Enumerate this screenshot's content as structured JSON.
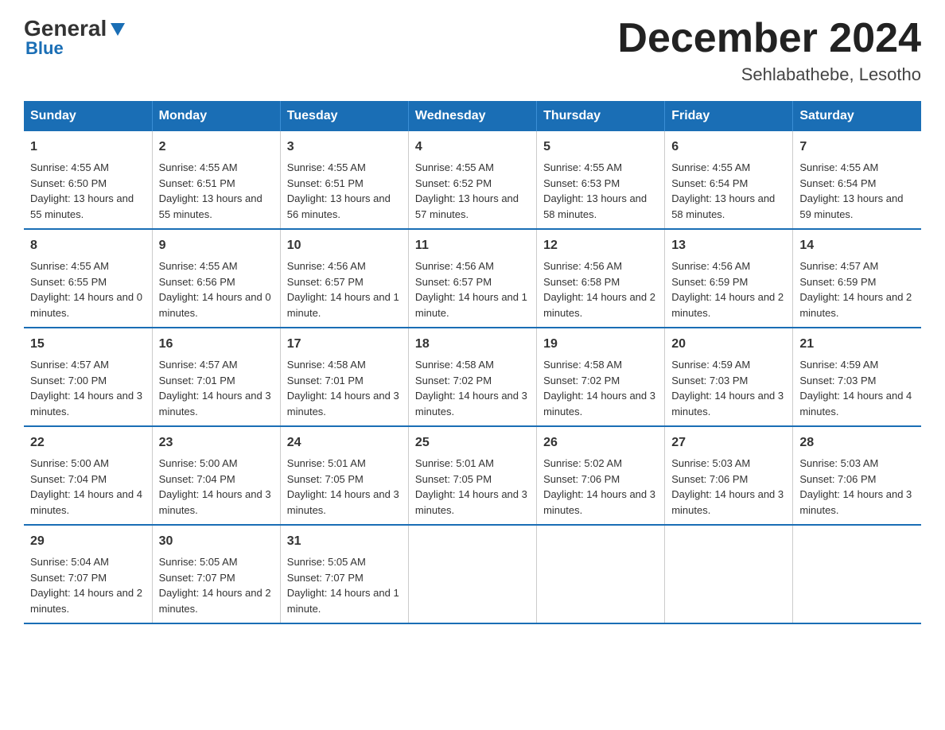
{
  "header": {
    "logo_general": "General",
    "logo_blue": "Blue",
    "month_title": "December 2024",
    "location": "Sehlabathebe, Lesotho"
  },
  "weekdays": [
    "Sunday",
    "Monday",
    "Tuesday",
    "Wednesday",
    "Thursday",
    "Friday",
    "Saturday"
  ],
  "weeks": [
    [
      {
        "day": "1",
        "sunrise": "4:55 AM",
        "sunset": "6:50 PM",
        "daylight": "13 hours and 55 minutes."
      },
      {
        "day": "2",
        "sunrise": "4:55 AM",
        "sunset": "6:51 PM",
        "daylight": "13 hours and 55 minutes."
      },
      {
        "day": "3",
        "sunrise": "4:55 AM",
        "sunset": "6:51 PM",
        "daylight": "13 hours and 56 minutes."
      },
      {
        "day": "4",
        "sunrise": "4:55 AM",
        "sunset": "6:52 PM",
        "daylight": "13 hours and 57 minutes."
      },
      {
        "day": "5",
        "sunrise": "4:55 AM",
        "sunset": "6:53 PM",
        "daylight": "13 hours and 58 minutes."
      },
      {
        "day": "6",
        "sunrise": "4:55 AM",
        "sunset": "6:54 PM",
        "daylight": "13 hours and 58 minutes."
      },
      {
        "day": "7",
        "sunrise": "4:55 AM",
        "sunset": "6:54 PM",
        "daylight": "13 hours and 59 minutes."
      }
    ],
    [
      {
        "day": "8",
        "sunrise": "4:55 AM",
        "sunset": "6:55 PM",
        "daylight": "14 hours and 0 minutes."
      },
      {
        "day": "9",
        "sunrise": "4:55 AM",
        "sunset": "6:56 PM",
        "daylight": "14 hours and 0 minutes."
      },
      {
        "day": "10",
        "sunrise": "4:56 AM",
        "sunset": "6:57 PM",
        "daylight": "14 hours and 1 minute."
      },
      {
        "day": "11",
        "sunrise": "4:56 AM",
        "sunset": "6:57 PM",
        "daylight": "14 hours and 1 minute."
      },
      {
        "day": "12",
        "sunrise": "4:56 AM",
        "sunset": "6:58 PM",
        "daylight": "14 hours and 2 minutes."
      },
      {
        "day": "13",
        "sunrise": "4:56 AM",
        "sunset": "6:59 PM",
        "daylight": "14 hours and 2 minutes."
      },
      {
        "day": "14",
        "sunrise": "4:57 AM",
        "sunset": "6:59 PM",
        "daylight": "14 hours and 2 minutes."
      }
    ],
    [
      {
        "day": "15",
        "sunrise": "4:57 AM",
        "sunset": "7:00 PM",
        "daylight": "14 hours and 3 minutes."
      },
      {
        "day": "16",
        "sunrise": "4:57 AM",
        "sunset": "7:01 PM",
        "daylight": "14 hours and 3 minutes."
      },
      {
        "day": "17",
        "sunrise": "4:58 AM",
        "sunset": "7:01 PM",
        "daylight": "14 hours and 3 minutes."
      },
      {
        "day": "18",
        "sunrise": "4:58 AM",
        "sunset": "7:02 PM",
        "daylight": "14 hours and 3 minutes."
      },
      {
        "day": "19",
        "sunrise": "4:58 AM",
        "sunset": "7:02 PM",
        "daylight": "14 hours and 3 minutes."
      },
      {
        "day": "20",
        "sunrise": "4:59 AM",
        "sunset": "7:03 PM",
        "daylight": "14 hours and 3 minutes."
      },
      {
        "day": "21",
        "sunrise": "4:59 AM",
        "sunset": "7:03 PM",
        "daylight": "14 hours and 4 minutes."
      }
    ],
    [
      {
        "day": "22",
        "sunrise": "5:00 AM",
        "sunset": "7:04 PM",
        "daylight": "14 hours and 4 minutes."
      },
      {
        "day": "23",
        "sunrise": "5:00 AM",
        "sunset": "7:04 PM",
        "daylight": "14 hours and 3 minutes."
      },
      {
        "day": "24",
        "sunrise": "5:01 AM",
        "sunset": "7:05 PM",
        "daylight": "14 hours and 3 minutes."
      },
      {
        "day": "25",
        "sunrise": "5:01 AM",
        "sunset": "7:05 PM",
        "daylight": "14 hours and 3 minutes."
      },
      {
        "day": "26",
        "sunrise": "5:02 AM",
        "sunset": "7:06 PM",
        "daylight": "14 hours and 3 minutes."
      },
      {
        "day": "27",
        "sunrise": "5:03 AM",
        "sunset": "7:06 PM",
        "daylight": "14 hours and 3 minutes."
      },
      {
        "day": "28",
        "sunrise": "5:03 AM",
        "sunset": "7:06 PM",
        "daylight": "14 hours and 3 minutes."
      }
    ],
    [
      {
        "day": "29",
        "sunrise": "5:04 AM",
        "sunset": "7:07 PM",
        "daylight": "14 hours and 2 minutes."
      },
      {
        "day": "30",
        "sunrise": "5:05 AM",
        "sunset": "7:07 PM",
        "daylight": "14 hours and 2 minutes."
      },
      {
        "day": "31",
        "sunrise": "5:05 AM",
        "sunset": "7:07 PM",
        "daylight": "14 hours and 1 minute."
      },
      null,
      null,
      null,
      null
    ]
  ]
}
